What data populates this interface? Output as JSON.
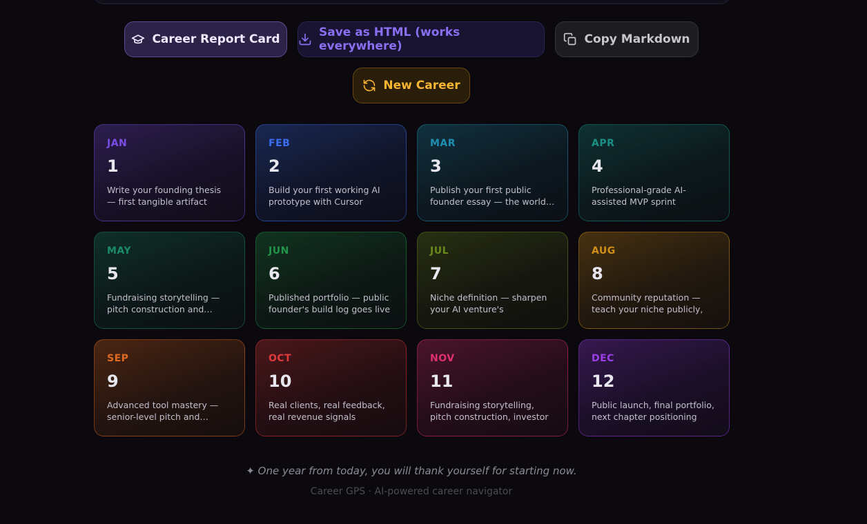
{
  "actions": {
    "report_card_label": "Career Report Card",
    "save_html_label": "Save as HTML (works everywhere)",
    "copy_markdown_label": "Copy Markdown",
    "new_career_label": "New Career"
  },
  "months": [
    {
      "month": "JAN",
      "number": "1",
      "description": "Write your founding thesis — first tangible artifact exists",
      "color": "#7b4fe6"
    },
    {
      "month": "FEB",
      "number": "2",
      "description": "Build your first working AI prototype with Cursor",
      "color": "#3b6ef0"
    },
    {
      "month": "MAR",
      "number": "3",
      "description": "Publish your first public founder essay — the world…",
      "color": "#1e8fb0"
    },
    {
      "month": "APR",
      "number": "4",
      "description": "Professional-grade AI-assisted MVP sprint workflow",
      "color": "#199086"
    },
    {
      "month": "MAY",
      "number": "5",
      "description": "Fundraising storytelling — pitch construction and…",
      "color": "#1a8a68"
    },
    {
      "month": "JUN",
      "number": "6",
      "description": "Published portfolio — public founder's build log goes live",
      "color": "#21964a"
    },
    {
      "month": "JUL",
      "number": "7",
      "description": "Niche definition — sharpen your AI venture's defensible…",
      "color": "#6a8a1c"
    },
    {
      "month": "AUG",
      "number": "8",
      "description": "Community reputation — teach your niche publicly, ear…",
      "color": "#d08f16"
    },
    {
      "month": "SEP",
      "number": "9",
      "description": "Advanced tool mastery — senior-level pitch and…",
      "color": "#e06a1f"
    },
    {
      "month": "OCT",
      "number": "10",
      "description": "Real clients, real feedback, real revenue signals",
      "color": "#e03a3a"
    },
    {
      "month": "NOV",
      "number": "11",
      "description": "Fundraising storytelling, pitch construction, investor pursuit",
      "color": "#e0306e"
    },
    {
      "month": "DEC",
      "number": "12",
      "description": "Public launch, final portfolio, next chapter positioning",
      "color": "#9a3ee8"
    }
  ],
  "footer": {
    "quote": "✦ One year from today, you will thank yourself for starting now.",
    "credit": "Career GPS · AI-powered career navigator"
  }
}
